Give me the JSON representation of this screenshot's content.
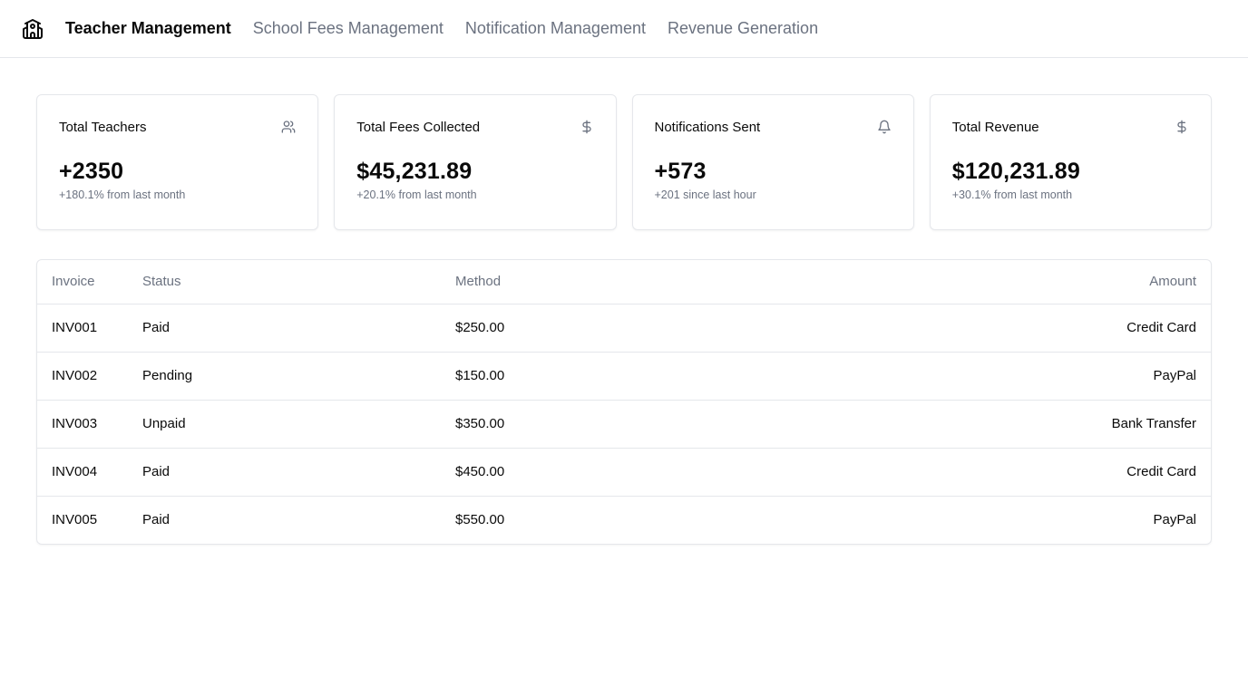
{
  "nav": {
    "logo_icon": "school-building-icon",
    "links": [
      {
        "label": "Teacher Management",
        "active": true
      },
      {
        "label": "School Fees Management",
        "active": false
      },
      {
        "label": "Notification Management",
        "active": false
      },
      {
        "label": "Revenue Generation",
        "active": false
      }
    ]
  },
  "cards": [
    {
      "title": "Total Teachers",
      "icon": "users-icon",
      "value": "+2350",
      "sub": "+180.1% from last month"
    },
    {
      "title": "Total Fees Collected",
      "icon": "dollar-icon",
      "value": "$45,231.89",
      "sub": "+20.1% from last month"
    },
    {
      "title": "Notifications Sent",
      "icon": "bell-icon",
      "value": "+573",
      "sub": "+201 since last hour"
    },
    {
      "title": "Total Revenue",
      "icon": "dollar-icon",
      "value": "$120,231.89",
      "sub": "+30.1% from last month"
    }
  ],
  "table": {
    "headers": [
      "Invoice",
      "Status",
      "Method",
      "Amount"
    ],
    "rows": [
      [
        "INV001",
        "Paid",
        "$250.00",
        "Credit Card"
      ],
      [
        "INV002",
        "Pending",
        "$150.00",
        "PayPal"
      ],
      [
        "INV003",
        "Unpaid",
        "$350.00",
        "Bank Transfer"
      ],
      [
        "INV004",
        "Paid",
        "$450.00",
        "Credit Card"
      ],
      [
        "INV005",
        "Paid",
        "$550.00",
        "PayPal"
      ]
    ]
  },
  "colors": {
    "muted": "#6b7280",
    "border": "#e5e7eb",
    "text": "#0a0a0a"
  }
}
